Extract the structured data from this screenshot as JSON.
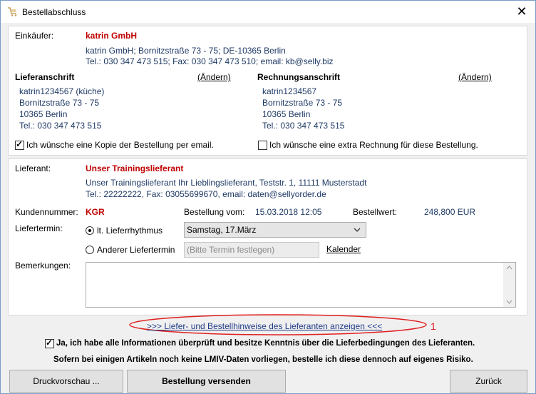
{
  "window": {
    "title": "Bestellabschluss",
    "close_glyph": "✕"
  },
  "buyer": {
    "label": "Einkäufer:",
    "name": "katrin GmbH",
    "address": "katrin GmbH; Bornitzstraße 73 - 75; DE-10365 Berlin",
    "contact": "Tel.: 030 347 473 515; Fax: 030 347 473 510; email: kb@selly.biz"
  },
  "delivery_address": {
    "heading": "Lieferanschrift",
    "change_link": "(Ändern)",
    "lines": [
      "katrin1234567 (küche)",
      "Bornitzstraße 73 - 75",
      "10365 Berlin",
      "Tel.: 030 347 473 515"
    ]
  },
  "billing_address": {
    "heading": "Rechnungsanschrift",
    "change_link": "(Ändern)",
    "lines": [
      "katrin1234567",
      "Bornitzstraße 73 - 75",
      "10365 Berlin",
      "Tel.: 030 347 473 515"
    ]
  },
  "options": {
    "copy_email": {
      "label": "Ich wünsche eine Kopie der Bestellung per email.",
      "checked": true
    },
    "extra_invoice": {
      "label": "Ich wünsche eine extra Rechnung für diese Bestellung.",
      "checked": false
    }
  },
  "supplier": {
    "label": "Lieferant:",
    "name": "Unser Trainingslieferant",
    "address": "Unser Trainingslieferant Ihr Lieblingslieferant, Teststr. 1, 11111 Musterstadt",
    "contact": "Tel.: 22222222, Fax: 03055699670, email: daten@sellyorder.de"
  },
  "order": {
    "customer_number_label": "Kundennummer:",
    "customer_number": "KGR",
    "order_from_label": "Bestellung vom:",
    "order_from": "15.03.2018 12:05",
    "order_value_label": "Bestellwert:",
    "order_value": "248,800 EUR"
  },
  "delivery": {
    "label": "Liefertermin:",
    "rhythm_label": "lt. Lieferrhythmus",
    "rhythm_selected": true,
    "rhythm_value": "Samstag, 17.März",
    "other_label": "Anderer Liefertermin",
    "other_selected": false,
    "other_placeholder": "(Bitte Termin festlegen)",
    "calendar_link": "Kalender"
  },
  "remarks": {
    "label": "Bemerkungen:",
    "value": ""
  },
  "hints_link": ">>> Liefer- und Bestellhinweise des Lieferanten anzeigen <<<",
  "annotation_number": "1",
  "accent_red": "#c00000",
  "confirm": {
    "label": "Ja, ich habe alle Informationen überprüft und besitze Kenntnis über die Lieferbedingungen des Lieferanten.",
    "checked": true
  },
  "lmiv_notice": "Sofern bei einigen Artikeln noch keine LMIV-Daten vorliegen, bestelle ich diese dennoch auf eigenes Risiko.",
  "buttons": {
    "preview": "Druckvorschau ...",
    "send": "Bestellung versenden",
    "back": "Zurück"
  }
}
